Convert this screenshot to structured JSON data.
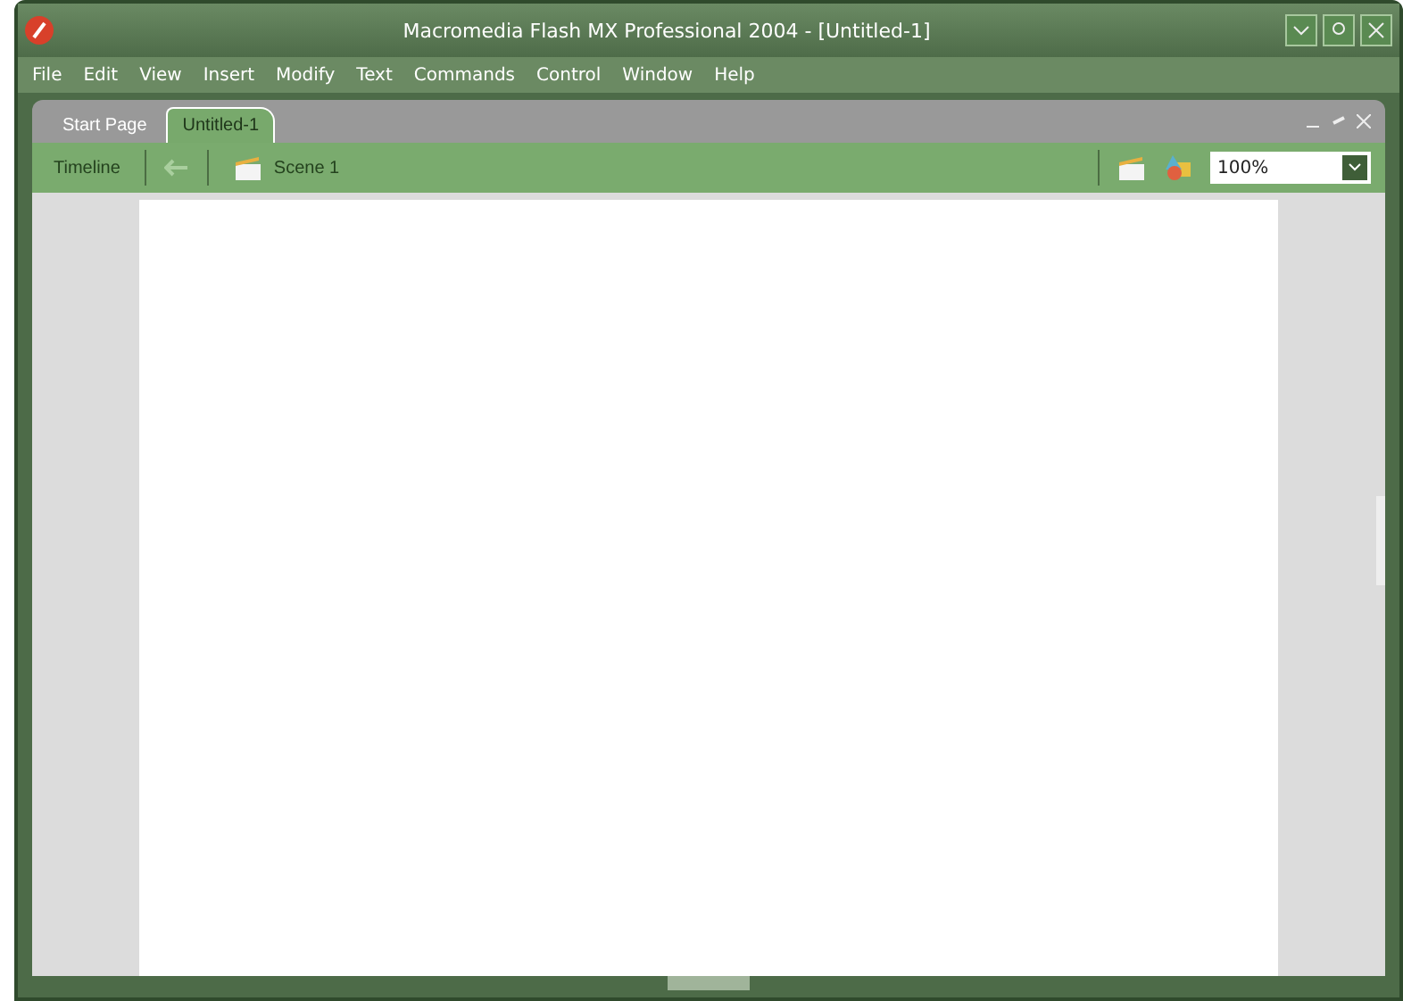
{
  "window": {
    "title": "Macromedia Flash MX Professional 2004 - [Untitled-1]"
  },
  "menu": [
    "File",
    "Edit",
    "View",
    "Insert",
    "Modify",
    "Text",
    "Commands",
    "Control",
    "Window",
    "Help"
  ],
  "tabs": [
    {
      "label": "Start Page",
      "selected": false
    },
    {
      "label": "Untitled-1",
      "selected": true
    }
  ],
  "toolbar": {
    "timeline": "Timeline",
    "scene": "Scene 1",
    "zoom": "100%"
  }
}
